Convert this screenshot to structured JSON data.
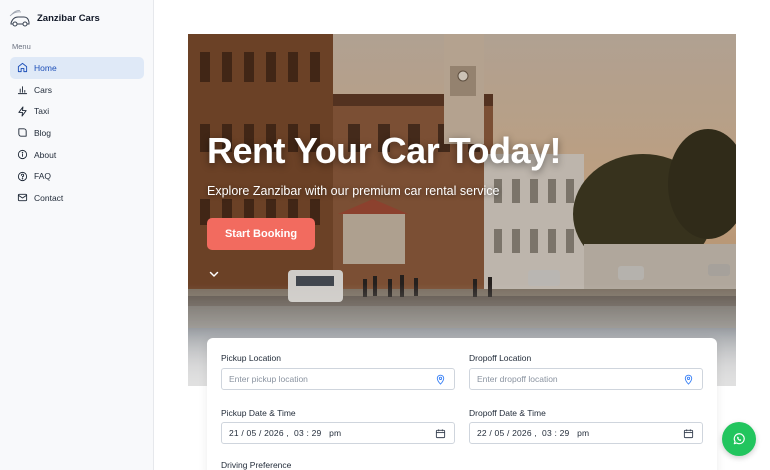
{
  "brand": {
    "name": "Zanzibar Cars",
    "logo_icon": "car-logo-icon"
  },
  "sidebar": {
    "menu_label": "Menu",
    "items": [
      {
        "label": "Home",
        "icon": "home-icon",
        "active": true
      },
      {
        "label": "Cars",
        "icon": "bar-chart-icon",
        "active": false
      },
      {
        "label": "Taxi",
        "icon": "zap-icon",
        "active": false
      },
      {
        "label": "Blog",
        "icon": "book-icon",
        "active": false
      },
      {
        "label": "About",
        "icon": "info-icon",
        "active": false
      },
      {
        "label": "FAQ",
        "icon": "help-circle-icon",
        "active": false
      },
      {
        "label": "Contact",
        "icon": "mail-icon",
        "active": false
      }
    ]
  },
  "hero": {
    "title": "Rent Your Car Today!",
    "subtitle": "Explore Zanzibar with our premium car rental service",
    "cta_label": "Start Booking",
    "scroll_icon": "chevron-down-icon"
  },
  "booking": {
    "pickup_location": {
      "label": "Pickup Location",
      "placeholder": "Enter pickup location",
      "icon": "map-pin-icon"
    },
    "dropoff_location": {
      "label": "Dropoff Location",
      "placeholder": "Enter dropoff location",
      "icon": "map-pin-icon"
    },
    "pickup_datetime": {
      "label": "Pickup Date & Time",
      "value": "21 / 05 / 2026 ,  03 : 29   pm",
      "icon": "calendar-icon"
    },
    "dropoff_datetime": {
      "label": "Dropoff Date & Time",
      "value": "22 / 05 / 2026 ,  03 : 29   pm",
      "icon": "calendar-icon"
    },
    "driving_preference": {
      "label": "Driving Preference"
    }
  },
  "fab": {
    "icon": "whatsapp-icon"
  },
  "colors": {
    "accent": "#f26b5f",
    "active_nav_bg": "#dfe9f7",
    "active_nav_text": "#1d4fb8",
    "whatsapp": "#22c55e"
  }
}
